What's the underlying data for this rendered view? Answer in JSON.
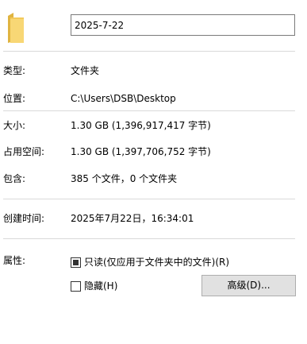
{
  "name_field": {
    "value": "2025-7-22"
  },
  "properties": {
    "type": {
      "label": "类型:",
      "value": "文件夹"
    },
    "location": {
      "label": "位置:",
      "value": "C:\\Users\\DSB\\Desktop"
    },
    "size": {
      "label": "大小:",
      "value": "1.30 GB (1,396,917,417 字节)"
    },
    "size_on_disk": {
      "label": "占用空间:",
      "value": "1.30 GB (1,397,706,752 字节)"
    },
    "contains": {
      "label": "包含:",
      "value": "385 个文件，0 个文件夹"
    },
    "created": {
      "label": "创建时间:",
      "value": "2025年7月22日，16:34:01"
    }
  },
  "attributes": {
    "label": "属性:",
    "readonly": {
      "label": "只读(仅应用于文件夹中的文件)(R)",
      "state": "indeterminate"
    },
    "hidden": {
      "label": "隐藏(H)",
      "state": "unchecked"
    },
    "advanced_button_label": "高级(D)..."
  },
  "icons": {
    "folder": "folder-icon"
  },
  "colors": {
    "folder_yellow": "#f8d775",
    "folder_dark": "#e0b440",
    "divider": "#d9d9d9",
    "button_bg": "#e1e1e1"
  }
}
